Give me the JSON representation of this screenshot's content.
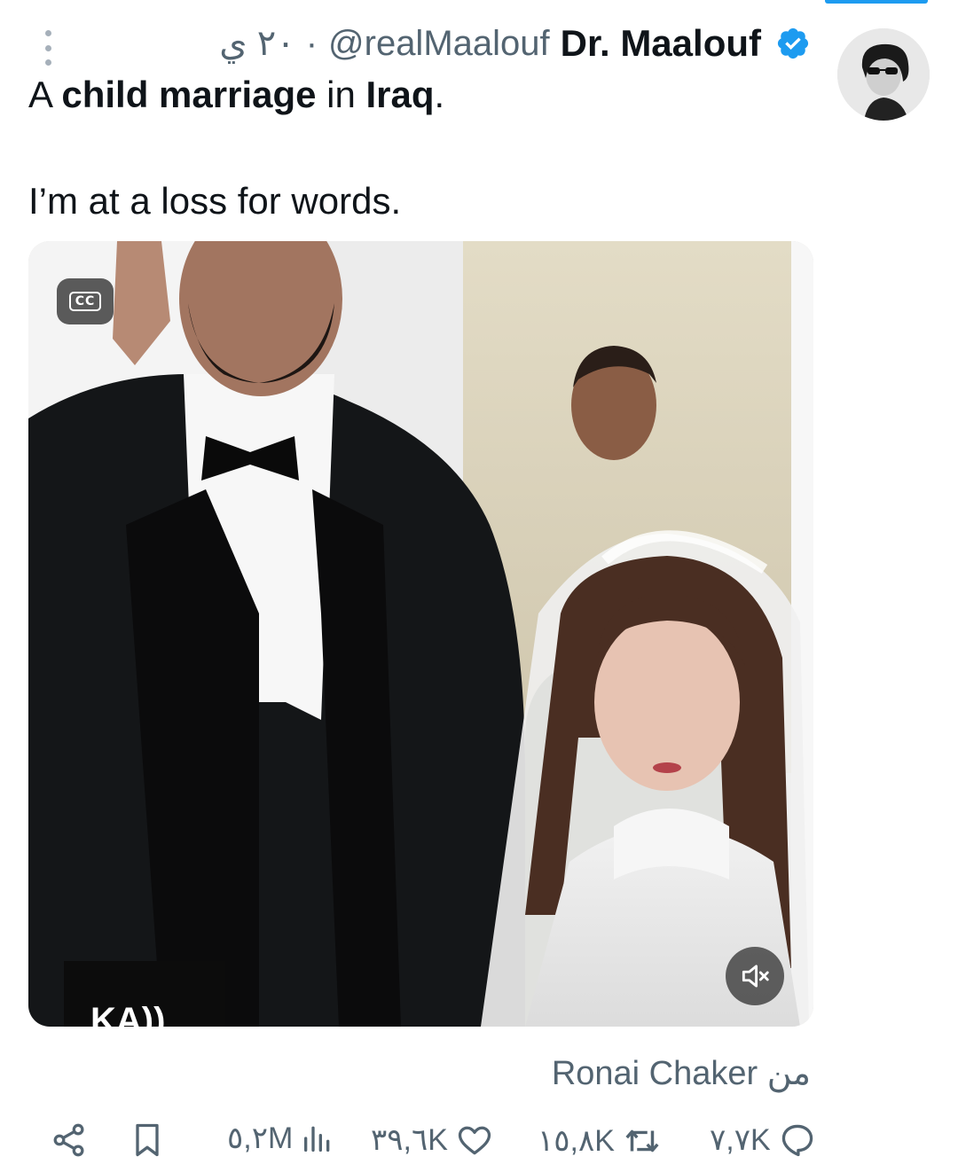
{
  "tweet": {
    "time": "٢٠ ي",
    "separator": "·",
    "handle": "@realMaalouf",
    "display_name": "Dr. Maalouf",
    "text_line1_plain_a": "A ",
    "text_line1_bold_a": "child marriage",
    "text_line1_plain_b": " in ",
    "text_line1_bold_b": "Iraq",
    "text_line1_plain_c": ".",
    "text_line2": "I’m at a loss for words."
  },
  "media": {
    "cc_label": "CC",
    "watermark_text": "KA))"
  },
  "attribution": {
    "prefix": "من",
    "source": "Ronai Chaker"
  },
  "actions": {
    "views": "٥,٢M",
    "likes": "٣٩,٦K",
    "retweets": "١٥,٨K",
    "replies": "٧,٧K"
  },
  "colors": {
    "accent": "#1d9bf0",
    "muted_text": "#536471",
    "primary_text": "#0f1419"
  },
  "icons": [
    "more-vertical-icon",
    "verified-badge-icon",
    "cc-icon",
    "mute-icon",
    "share-icon",
    "bookmark-icon",
    "views-icon",
    "like-icon",
    "retweet-icon",
    "reply-icon"
  ]
}
